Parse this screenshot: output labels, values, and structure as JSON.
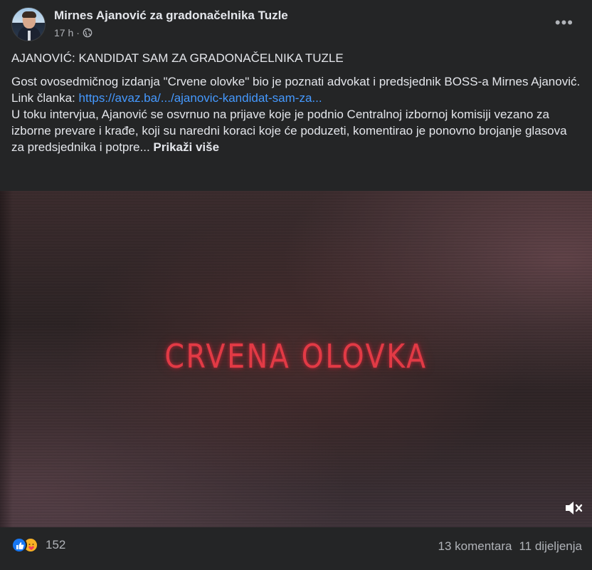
{
  "post": {
    "author": "Mirnes Ajanović za gradonačelnika Tuzle",
    "time": "17 h",
    "separator": "·",
    "privacy_icon": "globe-icon",
    "more_icon": "more-options-icon",
    "headline": "AJANOVIĆ: KANDIDAT SAM ZA GRADONAČELNIKA TUZLE",
    "body_line1": "Gost ovosedmičnog izdanja \"Crvene olovke\" bio je poznati advokat i predsjednik BOSS-a Mirnes Ajanović.",
    "link_label": "Link članka:",
    "link_text": "https://avaz.ba/.../ajanovic-kandidat-sam-za...",
    "body_line2": "U toku intervjua, Ajanović se osvrnuo na prijave koje je podnio Centralnoj izbornoj komisiji vezano za izborne prevare i krađe, koji su naredni koraci koje će poduzeti, komentirao je ponovno brojanje glasova za predsjednika i potpre...",
    "see_more": "Prikaži više"
  },
  "video": {
    "title_text": "CRVENA OLOVKA",
    "mute_icon": "volume-muted-icon"
  },
  "footer": {
    "reactions": [
      "like-icon",
      "care-icon"
    ],
    "reaction_count": "152",
    "comments": "13 komentara",
    "shares": "11 dijeljenja"
  },
  "colors": {
    "background": "#242526",
    "link": "#4599ff",
    "title_red": "#e23a45",
    "like_blue": "#1877f2"
  }
}
